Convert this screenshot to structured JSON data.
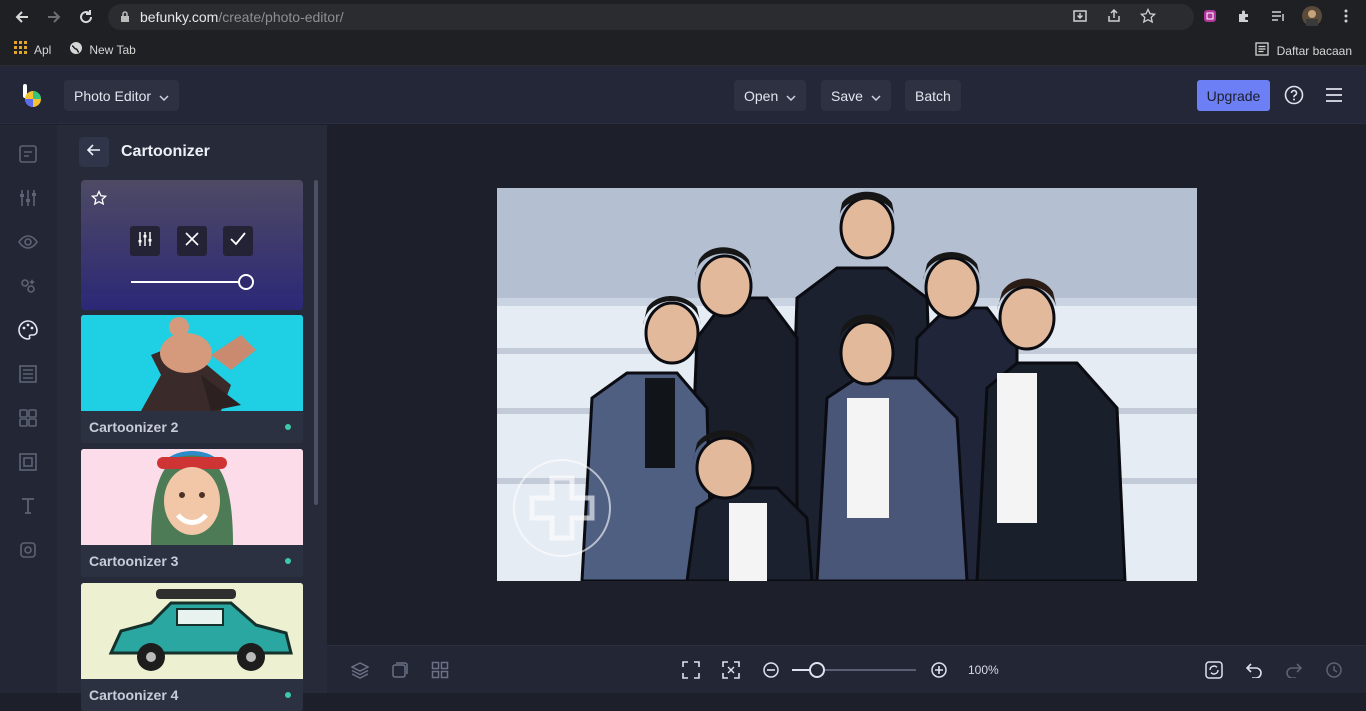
{
  "browser": {
    "url_host": "befunky.com",
    "url_path": "/create/photo-editor/",
    "bookmarks": [
      {
        "label": "Apl",
        "icon": "apps-grid-icon"
      },
      {
        "label": "New Tab",
        "icon": "globe-icon"
      }
    ],
    "reading_list": "Daftar bacaan"
  },
  "topbar": {
    "editor_menu": "Photo Editor",
    "open": "Open",
    "save": "Save",
    "batch": "Batch",
    "upgrade": "Upgrade"
  },
  "panel": {
    "title": "Cartoonizer",
    "active_slider_value": 1.0,
    "presets": [
      {
        "label": "Cartoonizer 2"
      },
      {
        "label": "Cartoonizer 3"
      },
      {
        "label": "Cartoonizer 4"
      }
    ]
  },
  "canvas": {
    "watermark": "PLUS EFFECT"
  },
  "bottom": {
    "zoom_text": "100%",
    "zoom_level": 0.2
  },
  "colors": {
    "accent": "#6d7ff5",
    "preset_dot": "#3ec9a7",
    "app_bg": "#1d1f2b"
  }
}
